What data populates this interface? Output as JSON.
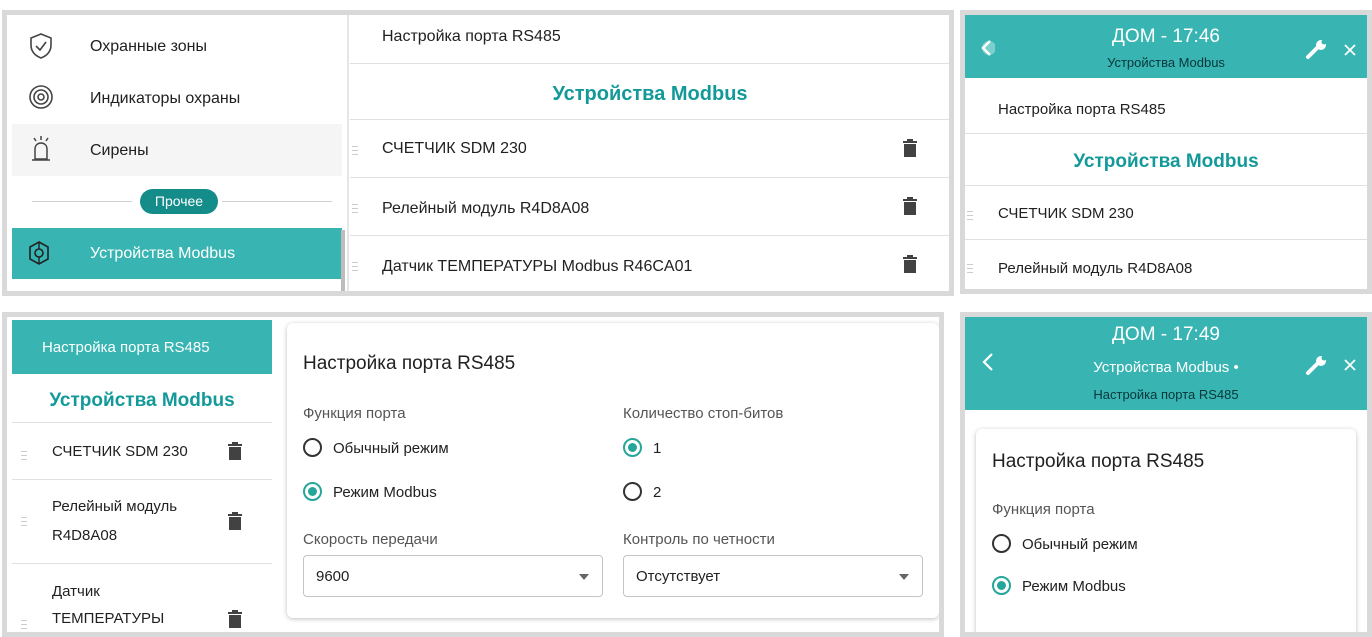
{
  "panel1": {
    "sidebar": [
      {
        "label": "Охранные зоны",
        "icon": "shield-check-icon"
      },
      {
        "label": "Индикаторы охраны",
        "icon": "radar-icon"
      },
      {
        "label": "Сирены",
        "icon": "siren-icon"
      }
    ],
    "section_chip": "Прочее",
    "active_item": {
      "label": "Устройства Modbus",
      "icon": "network-icon"
    },
    "top_link": "Настройка порта RS485",
    "section_title": "Устройства Modbus",
    "devices": [
      "СЧЕТЧИК SDM 230",
      "Релейный модуль R4D8A08",
      "Датчик ТЕМПЕРАТУРЫ Modbus R46CA01"
    ]
  },
  "panel2": {
    "header_title": "ДОМ - 17:46",
    "header_subtitle": "Устройства Modbus",
    "top_link": "Настройка порта RS485",
    "section_title": "Устройства Modbus",
    "devices": [
      "СЧЕТЧИК SDM 230",
      "Релейный модуль R4D8A08"
    ]
  },
  "panel3": {
    "active_link": "Настройка порта RS485",
    "section_title": "Устройства Modbus",
    "devices": [
      {
        "line1": "СЧЕТЧИК SDM 230",
        "line2": ""
      },
      {
        "line1": "Релейный модуль",
        "line2": "R4D8A08"
      },
      {
        "line1": "Датчик",
        "line2": "ТЕМПЕРАТУРЫ"
      }
    ],
    "form": {
      "title": "Настройка порта RS485",
      "port_function_label": "Функция порта",
      "port_options": [
        {
          "label": "Обычный режим",
          "selected": false
        },
        {
          "label": "Режим Modbus",
          "selected": true
        }
      ],
      "stop_bits_label": "Количество стоп-битов",
      "stop_bits_options": [
        {
          "label": "1",
          "selected": true
        },
        {
          "label": "2",
          "selected": false
        }
      ],
      "baud_label": "Скорость передачи",
      "baud_value": "9600",
      "parity_label": "Контроль по четности",
      "parity_value": "Отсутствует"
    }
  },
  "panel4": {
    "header_title": "ДОМ - 17:49",
    "header_subtitle": "Устройства Modbus •",
    "header_subtitle2": "Настройка порта RS485",
    "form_title": "Настройка порта RS485",
    "port_function_label": "Функция порта",
    "port_options": [
      {
        "label": "Обычный режим",
        "selected": false
      },
      {
        "label": "Режим Modbus",
        "selected": true
      }
    ]
  },
  "colors": {
    "accent": "#38b5b2",
    "teal_text": "#14999a",
    "radio": "#26a69a"
  }
}
